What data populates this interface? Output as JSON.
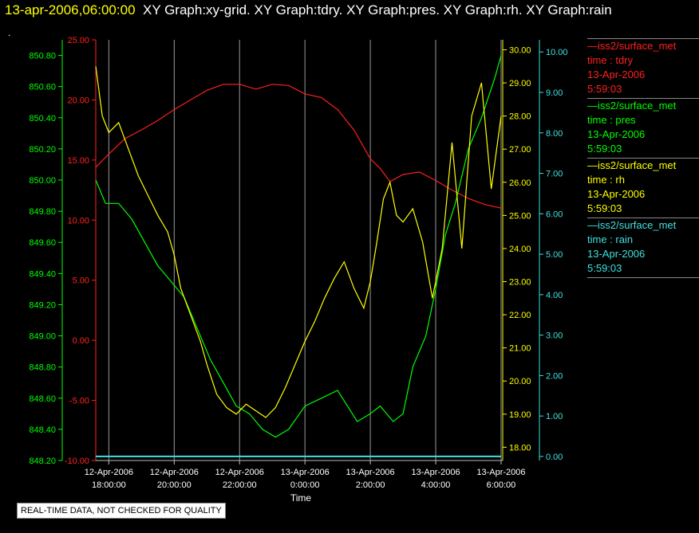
{
  "header": {
    "timestamp": "13-apr-2006,06:00:00",
    "graph_titles": "XY Graph:xy-grid.  XY Graph:tdry.  XY Graph:pres.  XY Graph:rh.  XY Graph:rain",
    "dot": "."
  },
  "footer": {
    "disclaimer": "REAL-TIME DATA, NOT CHECKED FOR QUALITY"
  },
  "legend": [
    {
      "name": "—iss2/surface_met",
      "var": "time : tdry",
      "date": "13-Apr-2006",
      "time": "5:59:03",
      "color": "#ff2020"
    },
    {
      "name": "—iss2/surface_met",
      "var": "time : pres",
      "date": "13-Apr-2006",
      "time": "5:59:03",
      "color": "#00ff00"
    },
    {
      "name": "—iss2/surface_met",
      "var": "time : rh",
      "date": "13-Apr-2006",
      "time": "5:59:03",
      "color": "#ffff00"
    },
    {
      "name": "—iss2/surface_met",
      "var": "time : rain",
      "date": "13-Apr-2006",
      "time": "5:59:03",
      "color": "#40e0e0"
    }
  ],
  "chart_data": {
    "type": "line",
    "xlabel": "Time",
    "x_ticks": [
      [
        "12-Apr-2006",
        "18:00:00"
      ],
      [
        "12-Apr-2006",
        "20:00:00"
      ],
      [
        "12-Apr-2006",
        "22:00:00"
      ],
      [
        "13-Apr-2006",
        "0:00:00"
      ],
      [
        "13-Apr-2006",
        "2:00:00"
      ],
      [
        "13-Apr-2006",
        "4:00:00"
      ],
      [
        "13-Apr-2006",
        "6:00:00"
      ]
    ],
    "x_tick_hours": [
      18,
      20,
      22,
      24,
      26,
      28,
      30
    ],
    "xlim_hours": [
      17.6,
      30.05
    ],
    "grid": "vertical",
    "axes": {
      "pres": {
        "color": "#00ff00",
        "side": "left-outer",
        "ylim": [
          848.2,
          850.9
        ],
        "ticks": [
          "848.20",
          "848.40",
          "848.60",
          "848.80",
          "849.00",
          "849.20",
          "849.40",
          "849.60",
          "849.80",
          "850.00",
          "850.20",
          "850.40",
          "850.60",
          "850.80"
        ]
      },
      "tdry": {
        "color": "#ff2020",
        "side": "left-inner",
        "ylim": [
          -10,
          25
        ],
        "ticks": [
          "-10.00",
          "-5.00",
          "0.00",
          "5.00",
          "10.00",
          "15.00",
          "20.00",
          "25.00"
        ]
      },
      "rh": {
        "color": "#ffff00",
        "side": "right-inner",
        "ylim": [
          17.6,
          30.3
        ],
        "ticks": [
          "18.00",
          "19.00",
          "20.00",
          "21.00",
          "22.00",
          "23.00",
          "24.00",
          "25.00",
          "26.00",
          "27.00",
          "28.00",
          "29.00",
          "30.00"
        ]
      },
      "rain": {
        "color": "#40e0e0",
        "side": "right-outer",
        "ylim": [
          -0.1,
          10.3
        ],
        "ticks": [
          "0.00",
          "1.00",
          "2.00",
          "3.00",
          "4.00",
          "5.00",
          "6.00",
          "7.00",
          "8.00",
          "9.00",
          "10.00"
        ]
      }
    },
    "series": [
      {
        "name": "tdry",
        "axis": "tdry",
        "color": "#ff2020",
        "x": [
          17.6,
          18.0,
          18.5,
          19.0,
          19.5,
          20.0,
          20.5,
          21.0,
          21.5,
          22.0,
          22.5,
          23.0,
          23.5,
          24.0,
          24.5,
          25.0,
          25.5,
          26.0,
          26.3,
          26.6,
          27.0,
          27.5,
          28.0,
          28.5,
          29.0,
          29.5,
          30.0
        ],
        "y": [
          14.4,
          15.5,
          16.8,
          17.5,
          18.3,
          19.2,
          20.0,
          20.8,
          21.3,
          21.3,
          20.9,
          21.3,
          21.2,
          20.5,
          20.2,
          19.2,
          17.5,
          15.1,
          14.3,
          13.2,
          13.8,
          14.0,
          13.3,
          12.5,
          11.8,
          11.3,
          11.0
        ]
      },
      {
        "name": "pres",
        "axis": "pres",
        "color": "#00ff00",
        "x": [
          17.6,
          17.9,
          18.3,
          18.7,
          19.1,
          19.5,
          19.9,
          20.3,
          20.7,
          21.1,
          21.5,
          21.9,
          22.3,
          22.7,
          23.1,
          23.5,
          24.0,
          24.5,
          25.0,
          25.3,
          25.6,
          26.0,
          26.3,
          26.7,
          27.0,
          27.3,
          27.7,
          28.0,
          28.3,
          28.6,
          29.0,
          29.4,
          29.8,
          30.0
        ],
        "y": [
          850.0,
          849.85,
          849.85,
          849.75,
          849.6,
          849.45,
          849.35,
          849.25,
          849.05,
          848.85,
          848.7,
          848.55,
          848.5,
          848.4,
          848.35,
          848.4,
          848.55,
          848.6,
          848.65,
          848.55,
          848.45,
          848.5,
          848.55,
          848.45,
          848.5,
          848.8,
          849.0,
          849.3,
          849.65,
          849.85,
          850.2,
          850.4,
          850.65,
          850.8
        ]
      },
      {
        "name": "rh",
        "axis": "rh",
        "color": "#ffff00",
        "x": [
          17.6,
          17.8,
          18.0,
          18.3,
          18.6,
          18.9,
          19.2,
          19.5,
          19.8,
          20.0,
          20.2,
          20.5,
          20.8,
          21.0,
          21.3,
          21.6,
          21.9,
          22.2,
          22.5,
          22.8,
          23.1,
          23.4,
          23.7,
          24.0,
          24.3,
          24.6,
          24.9,
          25.2,
          25.5,
          25.8,
          26.0,
          26.2,
          26.4,
          26.6,
          26.8,
          27.0,
          27.3,
          27.6,
          27.9,
          28.2,
          28.5,
          28.8,
          29.1,
          29.4,
          29.7,
          30.0
        ],
        "y": [
          29.5,
          28.0,
          27.5,
          27.8,
          27.0,
          26.2,
          25.6,
          25.0,
          24.5,
          23.8,
          22.8,
          22.0,
          21.2,
          20.5,
          19.6,
          19.2,
          19.0,
          19.3,
          19.1,
          18.9,
          19.2,
          19.8,
          20.5,
          21.2,
          21.8,
          22.5,
          23.1,
          23.6,
          22.8,
          22.2,
          23.0,
          24.2,
          25.5,
          26.0,
          25.0,
          24.8,
          25.2,
          24.2,
          22.5,
          24.0,
          27.2,
          24.0,
          28.0,
          29.0,
          25.8,
          28.0
        ]
      },
      {
        "name": "rain",
        "axis": "rain",
        "color": "#40e0e0",
        "x": [
          17.6,
          30.0
        ],
        "y": [
          0.0,
          0.0
        ]
      }
    ]
  }
}
